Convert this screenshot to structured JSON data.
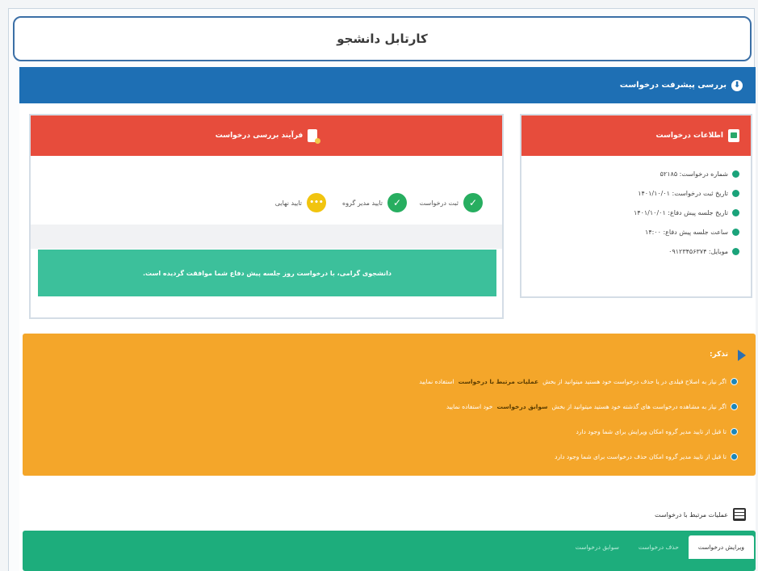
{
  "page_title": "کارتابل دانشجو",
  "section": {
    "title": "بررسی پیشرفت درخواست"
  },
  "info_card": {
    "title": "اطلاعات درخواست",
    "items": [
      "شماره درخواست: ۵۲۱۸۵",
      "تاریخ ثبت درخواست: ۱۴۰۱/۱۰/۰۱",
      "تاریخ جلسه پیش دفاع: ۱۴۰۱/۱۰/۰۱",
      "ساعت جلسه پیش دفاع: ۱۴:۰۰",
      "موبایل: ۰۹۱۲۳۴۵۶۳۷۴"
    ]
  },
  "process_card": {
    "title": "فرآیند بررسی درخواست",
    "steps": [
      {
        "label": "ثبت درخواست",
        "state": "done",
        "symbol": "✓"
      },
      {
        "label": "تایید مدیر گروه",
        "state": "done",
        "symbol": "✓"
      },
      {
        "label": "تایید نهایی",
        "state": "pending",
        "symbol": "•••"
      }
    ],
    "message": "دانشجوی گرامی، با درخواست روز جلسه پیش دفاع شما موافقت گردیده است."
  },
  "note": {
    "title": "تذکر:",
    "items": [
      {
        "text": "اگر نیاز به اصلاح فیلدی در یا حذف درخواست خود هستید میتوانید از بخش",
        "link": "عملیات مرتبط با درخواست",
        "suffix": "استفاده نمایید"
      },
      {
        "text": "اگر نیاز به مشاهده درخواست های گذشته خود هستید میتوانید از بخش",
        "link": "سوابق درخواست",
        "suffix": "خود استفاده نمایید"
      },
      {
        "text": "تا قبل از تایید مدیر گروه امکان ویرایش برای شما وجود دارد",
        "link": "",
        "suffix": ""
      },
      {
        "text": "تا قبل از تایید مدیر گروه امکان حذف درخواست برای شما وجود دارد",
        "link": "",
        "suffix": ""
      }
    ]
  },
  "related": {
    "title": "عملیات مرتبط با درخواست",
    "tabs": [
      "ویرایش درخواست",
      "حذف درخواست",
      "سوابق درخواست"
    ]
  },
  "colors": {
    "header_blue": "#1e6fb4",
    "card_red": "#e74c3c",
    "success_green": "#3cc09b",
    "note_orange": "#f4a62a",
    "tabs_teal": "#1dad7c"
  }
}
